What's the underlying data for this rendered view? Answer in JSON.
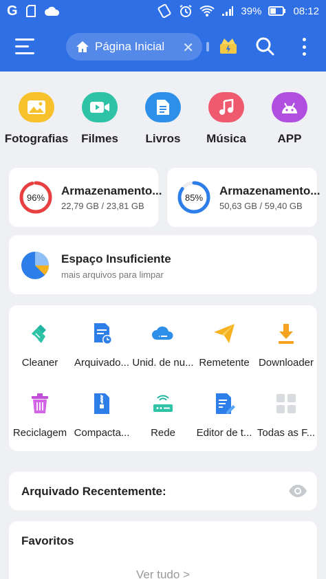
{
  "status_bar": {
    "left_icons": [
      "g-icon",
      "sd-card-icon",
      "cloud-icon"
    ],
    "g_letter": "G",
    "battery_percent": "39%",
    "time": "08:12"
  },
  "top_bar": {
    "home_label": "Página Inicial"
  },
  "categories": [
    {
      "label": "Fotografias",
      "icon": "image-icon",
      "color": "#f6c12a"
    },
    {
      "label": "Filmes",
      "icon": "video-icon",
      "color": "#2ec3a7"
    },
    {
      "label": "Livros",
      "icon": "document-icon",
      "color": "#2d8fe8"
    },
    {
      "label": "Música",
      "icon": "music-icon",
      "color": "#f05a6e"
    },
    {
      "label": "APP",
      "icon": "android-icon",
      "color": "#b04ee0"
    }
  ],
  "storage": [
    {
      "title": "Armazenamento...",
      "percent": "96%",
      "fraction": 0.96,
      "usage": "22,79 GB / 23,81 GB",
      "color": "#e84040"
    },
    {
      "title": "Armazenamento...",
      "percent": "85%",
      "fraction": 0.85,
      "usage": "50,63 GB / 59,40 GB",
      "color": "#2d7ee8"
    }
  ],
  "space_card": {
    "title": "Espaço Insuficiente",
    "subtitle": "mais arquivos para limpar"
  },
  "tools": [
    {
      "label": "Cleaner",
      "icon": "broom-icon"
    },
    {
      "label": "Arquivado...",
      "icon": "archive-clock-icon"
    },
    {
      "label": "Unid. de nu...",
      "icon": "cloud-drive-icon"
    },
    {
      "label": "Remetente",
      "icon": "paper-plane-icon"
    },
    {
      "label": "Downloader",
      "icon": "download-icon"
    },
    {
      "label": "Reciclagem",
      "icon": "trash-icon"
    },
    {
      "label": "Compacta...",
      "icon": "zip-icon"
    },
    {
      "label": "Rede",
      "icon": "router-icon"
    },
    {
      "label": "Editor de t...",
      "icon": "text-editor-icon"
    },
    {
      "label": "Todas as F...",
      "icon": "grid-icon"
    }
  ],
  "recent": {
    "title": "Arquivado Recentemente:"
  },
  "favorites": {
    "title": "Favoritos",
    "see_all": "Ver tudo >"
  }
}
